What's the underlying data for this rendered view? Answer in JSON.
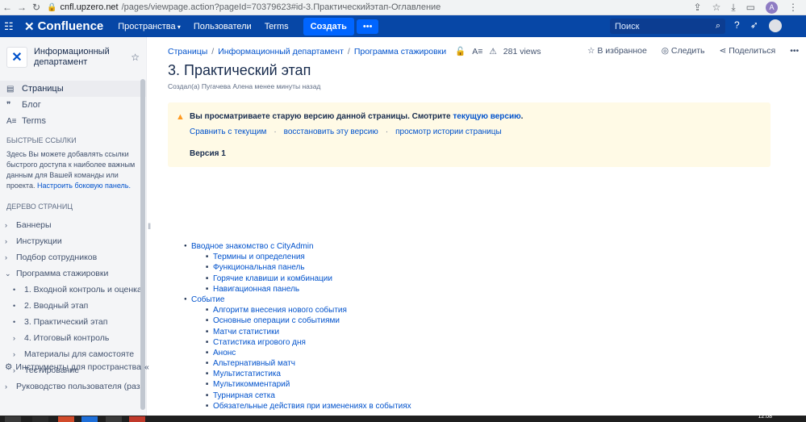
{
  "browser": {
    "url_host": "cnfl.upzero.net",
    "url_path": "/pages/viewpage.action?pageId=70379623#id-3.Практическийэтап-Оглавление"
  },
  "header": {
    "brand": "Confluence",
    "nav": [
      {
        "label": "Пространства",
        "dropdown": true
      },
      {
        "label": "Пользователи",
        "dropdown": false
      },
      {
        "label": "Terms",
        "dropdown": false
      }
    ],
    "create_label": "Создать",
    "more_label": "•••",
    "search_placeholder": "Поиск",
    "brand_color": "#0747a6"
  },
  "sidebar": {
    "space_name": "Информационный департамент",
    "items": [
      {
        "label": "Страницы",
        "icon": "pages-icon",
        "active": true
      },
      {
        "label": "Блог",
        "icon": "quote-icon",
        "active": false
      },
      {
        "label": "Terms",
        "icon": "terms-icon",
        "active": false
      }
    ],
    "quick_links_title": "БЫСТРЫЕ ССЫЛКИ",
    "quick_links_text": "Здесь Вы можете добавлять ссылки быстрого доступа к наиболее важным данным для Вашей команды или проекта.",
    "quick_links_link": "Настроить боковую панель.",
    "tree_title": "ДЕРЕВО СТРАНИЦ",
    "tree": [
      {
        "label": "Баннеры",
        "level": 0,
        "marker": "›"
      },
      {
        "label": "Инструкции",
        "level": 0,
        "marker": "›"
      },
      {
        "label": "Подбор сотрудников",
        "level": 0,
        "marker": "›"
      },
      {
        "label": "Программа стажировки",
        "level": 0,
        "marker": "⌄"
      },
      {
        "label": "1. Входной контроль и оценка",
        "level": 1,
        "marker": "•"
      },
      {
        "label": "2. Вводный этап",
        "level": 1,
        "marker": "•"
      },
      {
        "label": "3. Практический этап",
        "level": 1,
        "marker": "•"
      },
      {
        "label": "4. Итоговый контроль",
        "level": 1,
        "marker": "›"
      },
      {
        "label": "Материалы для самостояте",
        "level": 1,
        "marker": "›"
      },
      {
        "label": "Тестирование",
        "level": 1,
        "marker": "›"
      },
      {
        "label": "Руководство пользователя (разр",
        "level": 0,
        "marker": "›"
      }
    ],
    "tools_label": "Инструменты для пространства"
  },
  "page": {
    "breadcrumbs": [
      "Страницы",
      "Информационный департамент",
      "Программа стажировки"
    ],
    "views": "281 views",
    "actions": {
      "favorite": "В избранное",
      "watch": "Следить",
      "share": "Поделиться"
    },
    "title": "3. Практический этап",
    "byline": "Создал(а) Пугачева Алена менее минуты назад",
    "warning": {
      "message": "Вы просматриваете старую версию данной страницы. Смотрите",
      "current_link": "текущую версию",
      "compare": "Сравнить с текущим",
      "restore": "восстановить эту версию",
      "history": "просмотр истории страницы",
      "version": "Версия 1",
      "bg_color": "#fffae6"
    },
    "toc": [
      {
        "label": "Вводное знакомство с CityAdmin",
        "level": 1
      },
      {
        "label": "Термины и определения",
        "level": 2
      },
      {
        "label": "Функциональная панель",
        "level": 2
      },
      {
        "label": "Горячие клавиши и комбинации",
        "level": 2
      },
      {
        "label": "Навигационная панель",
        "level": 2
      },
      {
        "label": "Событие",
        "level": 1
      },
      {
        "label": "Алгоритм внесения нового события",
        "level": 2
      },
      {
        "label": "Основные операции с событиями",
        "level": 2
      },
      {
        "label": "Матчи статистики",
        "level": 2
      },
      {
        "label": "Статистика игрового дня",
        "level": 2
      },
      {
        "label": "Анонс",
        "level": 2
      },
      {
        "label": "Альтернативный матч",
        "level": 2
      },
      {
        "label": "Мультистатистика",
        "level": 2
      },
      {
        "label": "Мультикомментарий",
        "level": 2
      },
      {
        "label": "Турнирная сетка",
        "level": 2
      },
      {
        "label": "Обязательные действия при изменениях в событиях",
        "level": 2
      }
    ]
  },
  "taskbar": {
    "clock": "12:08"
  }
}
